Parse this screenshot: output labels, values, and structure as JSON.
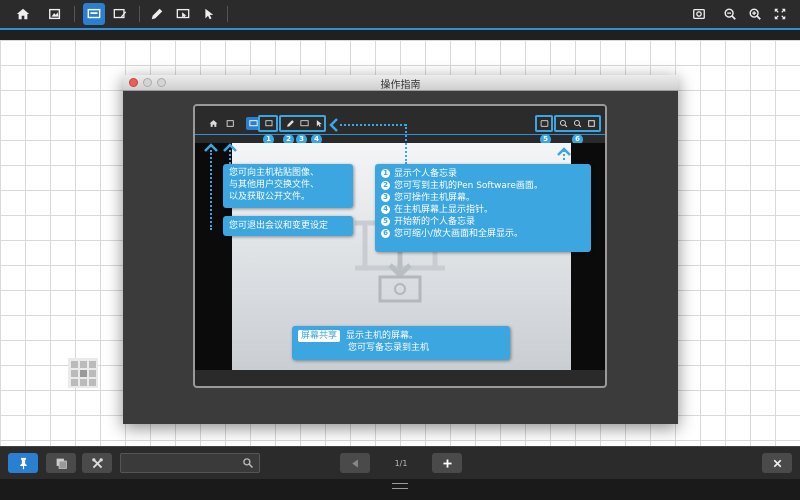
{
  "window": {
    "title": "操作指南"
  },
  "callouts": {
    "share_lines": [
      "您可向主机粘贴图像、",
      "与其他用户交换文件、",
      "以及获取公开文件。"
    ],
    "exit_text": "您可退出会议和变更设定",
    "features": [
      {
        "num": "1",
        "text": "显示个人备忘录"
      },
      {
        "num": "2",
        "text": "您可写到主机的Pen Software画面。"
      },
      {
        "num": "3",
        "text": "您可操作主机屏幕。"
      },
      {
        "num": "4",
        "text": "在主机屏幕上显示指针。"
      },
      {
        "num": "5",
        "text": "开始新的个人备忘录"
      },
      {
        "num": "6",
        "text": "您可缩小/放大画面和全屏显示。"
      }
    ],
    "screen_share": {
      "tag": "屏幕共享",
      "line1": "显示主机的屏幕。",
      "line2": "您可写备忘录到主机"
    }
  },
  "toolbar_numbers": [
    "1",
    "2",
    "3",
    "4",
    "5",
    "6"
  ],
  "bottom": {
    "search_placeholder": "",
    "page_indicator": "1/1"
  },
  "colors": {
    "accent": "#2a7fd0",
    "callout": "#3ba6df",
    "toolbar": "#2b2b2b"
  }
}
